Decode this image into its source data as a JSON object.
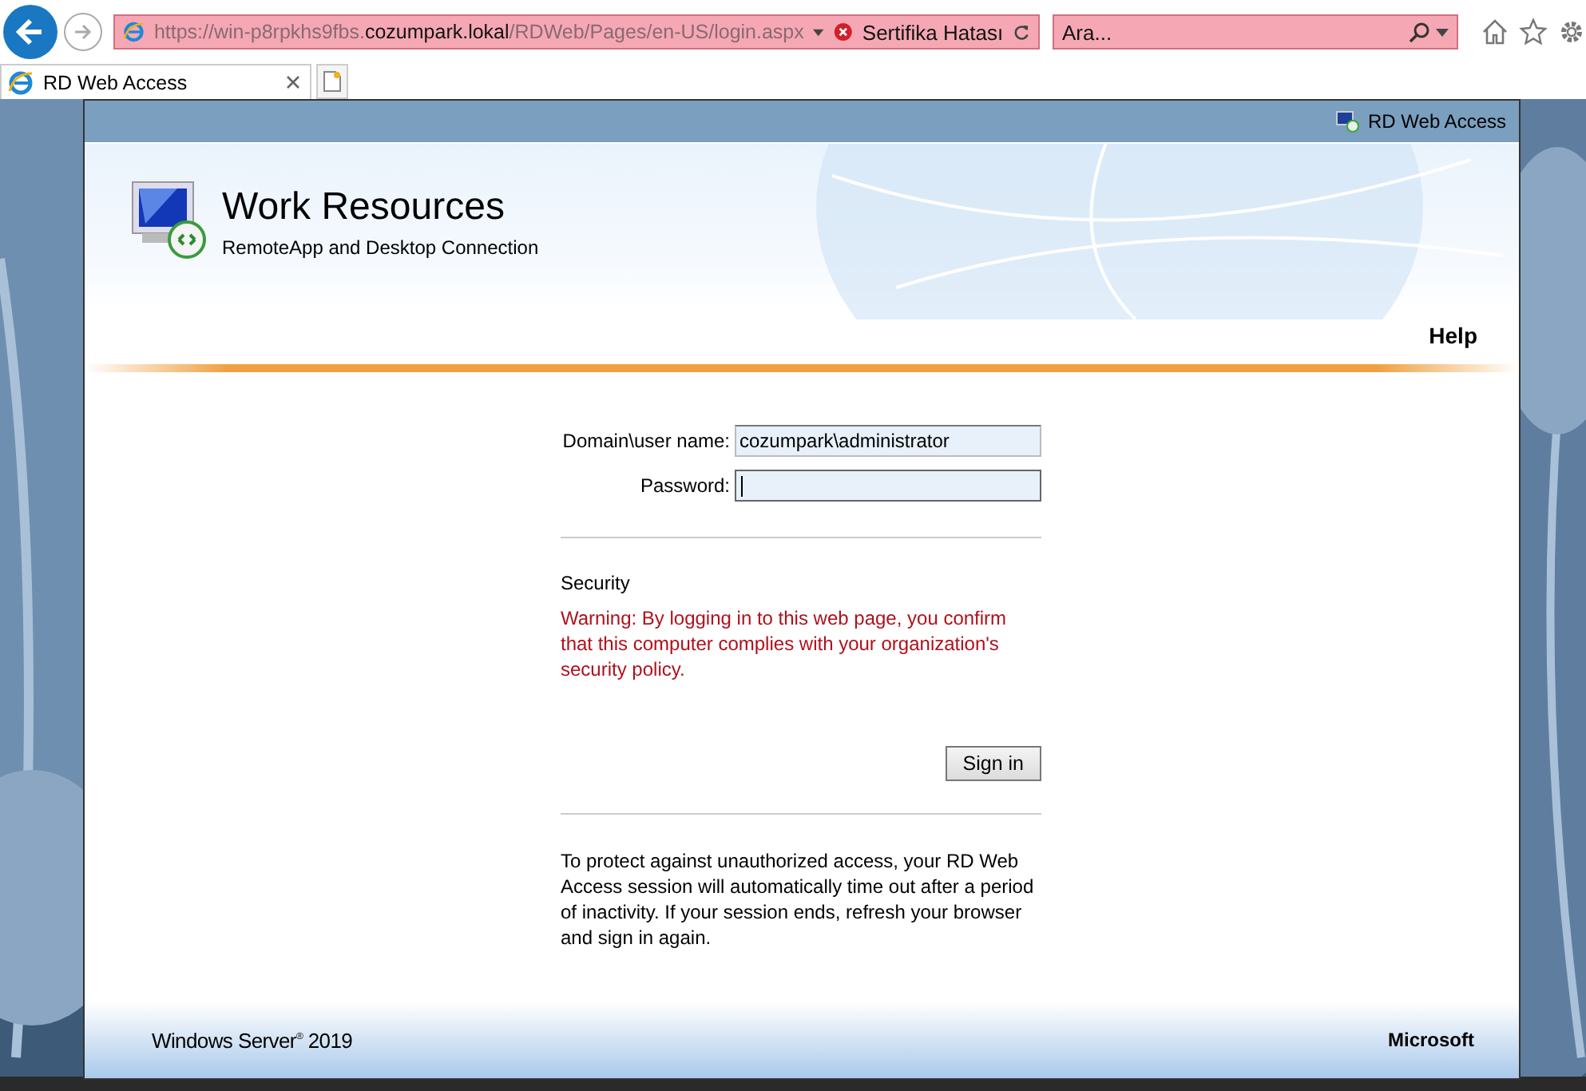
{
  "browser": {
    "address": {
      "url_parts": [
        {
          "text": "https://win-p8rpkhs9fbs.",
          "kind": "dim"
        },
        {
          "text": "cozumpark.lokal",
          "kind": "host"
        },
        {
          "text": "/RDWeb/Pages/en-US/login.aspx",
          "kind": "dim"
        }
      ],
      "certificate_error": "Sertifika Hatası"
    },
    "search": {
      "placeholder": "Ara..."
    },
    "tabs": [
      {
        "label": "RD Web Access",
        "selected": true
      }
    ]
  },
  "page": {
    "top_bar_label": "RD Web Access",
    "title": "Work Resources",
    "subtitle": "RemoteApp and Desktop Connection",
    "help_link": "Help",
    "fields": [
      {
        "label": "Domain\\user name:",
        "value": "cozumpark\\administrator",
        "kind": "text",
        "focused": false
      },
      {
        "label": "Password:",
        "kind": "password",
        "focused": true
      }
    ],
    "security_heading": "Security",
    "warning": "Warning: By logging in to this web page, you confirm that this computer complies with your organization's security policy.",
    "sign_in_button": "Sign in",
    "notice": "To protect against unauthorized access, your RD Web Access session will automatically time out after a period of inactivity. If your session ends, refresh your browser and sign in again.",
    "footer": {
      "product": "Windows Server$^{®}$ 2019",
      "vendor": "Microsoft"
    }
  }
}
